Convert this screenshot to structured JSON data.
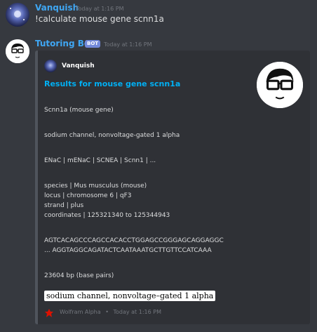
{
  "messages": [
    {
      "author": "Vanquish",
      "timestamp": "Today at 1:16 PM",
      "text": "!calculate mouse gene scnn1a",
      "author_color": "#3fa7f4"
    },
    {
      "author": "Tutoring Bot",
      "bot_badge": "BOT",
      "timestamp": "Today at 1:16 PM",
      "author_color": "#3fa7f4",
      "embed": {
        "author": "Vanquish",
        "title": "Results for mouse gene scnn1a",
        "lines": [
          "Scnn1a (mouse gene)",
          "sodium channel, nonvoltage-gated 1 alpha",
          "ENaC | mENaC | SCNEA | Scnn1 | ...",
          "species | Mus musculus (mouse)",
          "locus | chromosome 6 | qF3",
          "strand | plus",
          "coordinates | 125321340 to 125344943",
          "AGTCACAGCCCAGCCACACCTGGAGCCGGGAGCAGGAGGC",
          "... AGGTAGGCAGATACTCAATAAATGCTTGTTCCATCAAA",
          "23604 bp (base pairs)"
        ],
        "image_text": "sodium channel, nonvoltage–gated 1 alpha",
        "footer_source": "Wolfram Alpha",
        "footer_sep": "•",
        "footer_time": "Today at 1:16 PM"
      }
    }
  ]
}
